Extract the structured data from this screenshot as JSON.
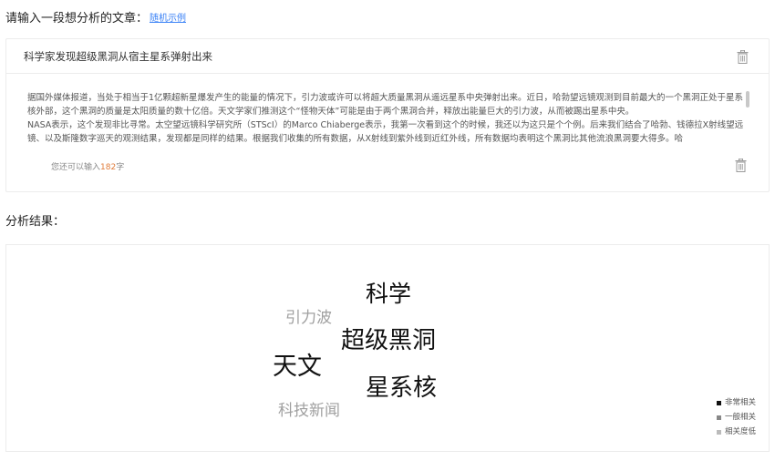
{
  "prompt": {
    "label": "请输入一段想分析的文章：",
    "example_link": "随机示例"
  },
  "input": {
    "title_value": "科学家发现超级黑洞从宿主星系弹射出来",
    "article_text": "据国外媒体报道，当处于相当于1亿颗超新星爆发产生的能量的情况下，引力波或许可以将超大质量黑洞从遥远星系中央弹射出来。近日，哈勃望远镜观测到目前最大的一个黑洞正处于星系核外部，这个黑洞的质量是太阳质量的数十亿倍。天文学家们推测这个“怪物天体”可能是由于两个黑洞合并，释放出能量巨大的引力波，从而被踢出星系中央。\nNASA表示，这个发现非比寻常。太空望远镜科学研究所（STScI）的Marco Chiaberge表示，我第一次看到这个的时候，我还以为这只是个个例。后来我们结合了哈勃、钱德拉X射线望远镜、以及斯隆数字巡天的观测结果，发现都是同样的结果。根据我们收集的所有数据，从X射线到紫外线到近红外线，所有数据均表明这个黑洞比其他流浪黑洞要大得多。哈",
    "counter_prefix": "您还可以输入",
    "counter_value": "182",
    "counter_suffix": "字",
    "icons": {
      "title_trash": "trash-icon",
      "article_trash": "trash-icon"
    }
  },
  "results": {
    "label": "分析结果：",
    "words": [
      {
        "text": "科学",
        "level": "high"
      },
      {
        "text": "引力波",
        "level": "low"
      },
      {
        "text": "超级黑洞",
        "level": "high"
      },
      {
        "text": "天文",
        "level": "high"
      },
      {
        "text": "星系核",
        "level": "high"
      },
      {
        "text": "科技新闻",
        "level": "low"
      }
    ],
    "legend": [
      {
        "label": "非常相关",
        "color": "#111111"
      },
      {
        "label": "一般相关",
        "color": "#888888"
      },
      {
        "label": "相关度低",
        "color": "#bbbbbb"
      }
    ]
  },
  "colors": {
    "high": "#111111",
    "mid": "#888888",
    "low": "#a0a0a0",
    "link": "#3b82f6",
    "counter": "#e07b39"
  }
}
